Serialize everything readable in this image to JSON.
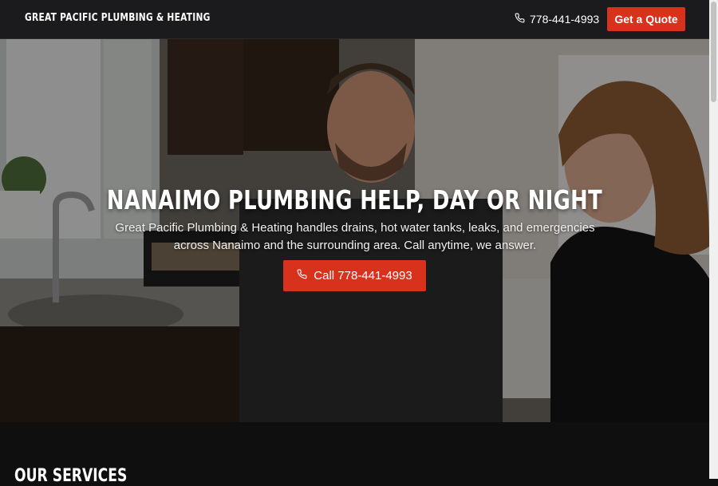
{
  "header": {
    "brand": "Great Pacific Plumbing & Heating",
    "phone": "778-441-4993",
    "quote_label": "Get a Quote"
  },
  "hero": {
    "title": "Nanaimo Plumbing Help, Day or Night",
    "subtitle": "Great Pacific Plumbing & Heating handles drains, hot water tanks, leaks, and emergencies across Nanaimo and the surrounding area. Call anytime, we answer.",
    "call_label": "Call 778-441-4993"
  },
  "services": {
    "title": "Our Services"
  },
  "colors": {
    "accent": "#d8311c",
    "header_bg": "#1b1b1d",
    "page_bg": "#0f0f10"
  },
  "icons": {
    "phone": "phone-icon"
  }
}
